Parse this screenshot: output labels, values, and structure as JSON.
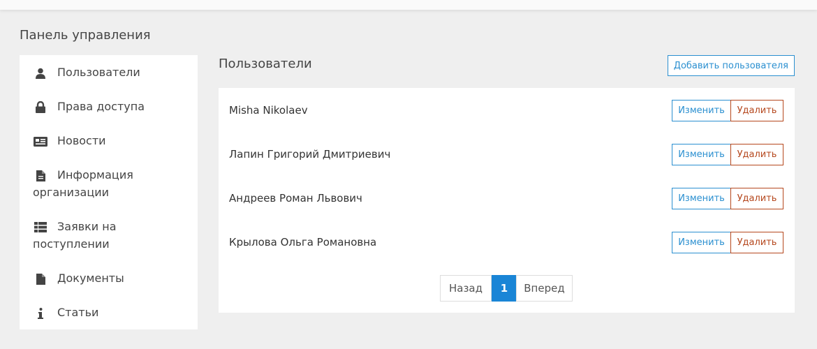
{
  "page": {
    "title": "Панель управления"
  },
  "sidebar": {
    "items": [
      {
        "label": "Пользователи",
        "icon": "user-icon"
      },
      {
        "label": "Права доступа",
        "icon": "lock-icon"
      },
      {
        "label": "Новости",
        "icon": "newspaper-icon"
      },
      {
        "label": "Информация организации",
        "icon": "file-icon"
      },
      {
        "label": "Заявки на поступлении",
        "icon": "list-icon"
      },
      {
        "label": "Документы",
        "icon": "file-icon"
      },
      {
        "label": "Статьи",
        "icon": "info-icon"
      }
    ]
  },
  "main": {
    "title": "Пользователи",
    "add_button": "Добавить пользователя",
    "edit_label": "Изменить",
    "delete_label": "Удалить",
    "users": [
      "Misha Nikolaev",
      "Лапин Григорий Дмитриевич",
      "Андреев Роман Львович",
      "Крылова Ольга Романовна"
    ]
  },
  "pagination": {
    "prev": "Назад",
    "current": "1",
    "next": "Вперед"
  },
  "colors": {
    "accent": "#2a8fd0",
    "danger": "#b5471d",
    "active_page": "#1a85d6"
  }
}
